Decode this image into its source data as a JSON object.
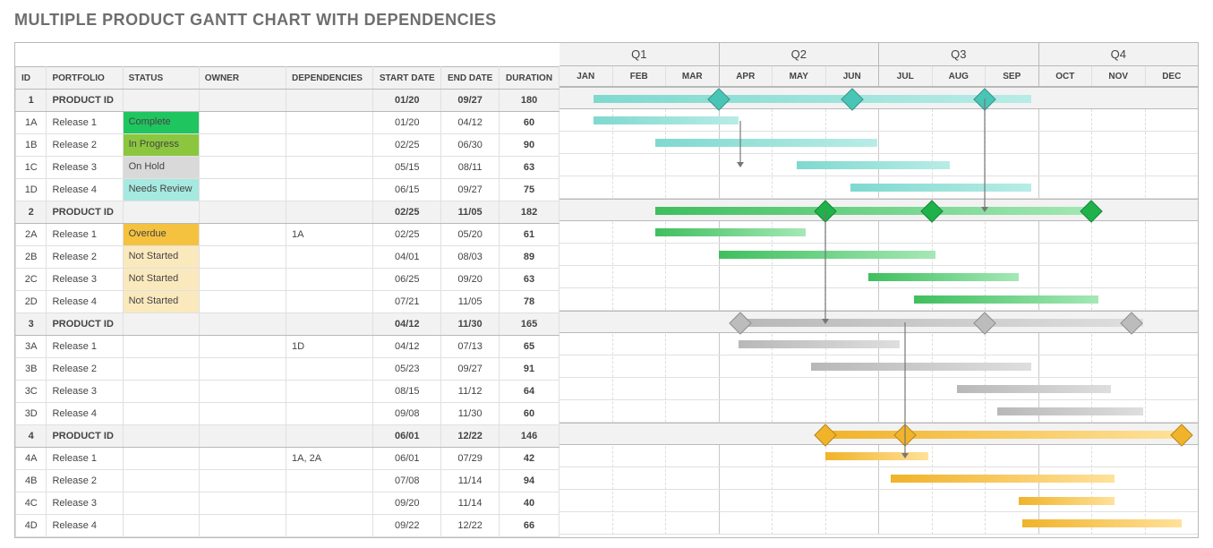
{
  "title": "MULTIPLE PRODUCT GANTT CHART WITH DEPENDENCIES",
  "columns": {
    "id": "ID",
    "portfolio": "PORTFOLIO",
    "status": "STATUS",
    "owner": "OWNER",
    "dependencies": "DEPENDENCIES",
    "start_date": "START DATE",
    "end_date": "END DATE",
    "duration": "DURATION"
  },
  "quarters": [
    "Q1",
    "Q2",
    "Q3",
    "Q4"
  ],
  "months": [
    "JAN",
    "FEB",
    "MAR",
    "APR",
    "MAY",
    "JUN",
    "JUL",
    "AUG",
    "SEP",
    "OCT",
    "NOV",
    "DEC"
  ],
  "status_colors": {
    "Complete": "#1fc65f",
    "In Progress": "#8cc63f",
    "On Hold": "#d9d9d9",
    "Needs Review": "#a6e9e0",
    "Overdue": "#f5c23f",
    "Not Started": "#fbe9be"
  },
  "product_colors": {
    "1": {
      "bar": "linear-gradient(90deg,#7fd9cf,#b8ece6)",
      "diamond": "#49c5b6"
    },
    "2": {
      "bar": "linear-gradient(90deg,#3fbf5e,#a5e8b6)",
      "diamond": "#1fb24a"
    },
    "3": {
      "bar": "linear-gradient(90deg,#b8b8b8,#dedede)",
      "diamond": "#bcbcbc"
    },
    "4": {
      "bar": "linear-gradient(90deg,#f0b32a,#ffe19a)",
      "diamond": "#f0b32a"
    }
  },
  "rows": [
    {
      "id": "1",
      "portfolio": "PRODUCT ID",
      "status": "",
      "owner": "",
      "dependencies": "",
      "start_date": "01/20",
      "end_date": "09/27",
      "duration": "180",
      "product": true,
      "group": "1",
      "diamonds": [
        4,
        6.5,
        9
      ]
    },
    {
      "id": "1A",
      "portfolio": "Release 1",
      "status": "Complete",
      "owner": "",
      "dependencies": "",
      "start_date": "01/20",
      "end_date": "04/12",
      "duration": "60",
      "group": "1"
    },
    {
      "id": "1B",
      "portfolio": "Release 2",
      "status": "In Progress",
      "owner": "",
      "dependencies": "",
      "start_date": "02/25",
      "end_date": "06/30",
      "duration": "90",
      "group": "1"
    },
    {
      "id": "1C",
      "portfolio": "Release 3",
      "status": "On Hold",
      "owner": "",
      "dependencies": "",
      "start_date": "05/15",
      "end_date": "08/11",
      "duration": "63",
      "group": "1"
    },
    {
      "id": "1D",
      "portfolio": "Release 4",
      "status": "Needs Review",
      "owner": "",
      "dependencies": "",
      "start_date": "06/15",
      "end_date": "09/27",
      "duration": "75",
      "group": "1"
    },
    {
      "id": "2",
      "portfolio": "PRODUCT ID",
      "status": "",
      "owner": "",
      "dependencies": "",
      "start_date": "02/25",
      "end_date": "11/05",
      "duration": "182",
      "product": true,
      "group": "2",
      "diamonds": [
        6,
        8,
        11
      ]
    },
    {
      "id": "2A",
      "portfolio": "Release 1",
      "status": "Overdue",
      "owner": "",
      "dependencies": "1A",
      "start_date": "02/25",
      "end_date": "05/20",
      "duration": "61",
      "group": "2"
    },
    {
      "id": "2B",
      "portfolio": "Release 2",
      "status": "Not Started",
      "owner": "",
      "dependencies": "",
      "start_date": "04/01",
      "end_date": "08/03",
      "duration": "89",
      "group": "2"
    },
    {
      "id": "2C",
      "portfolio": "Release 3",
      "status": "Not Started",
      "owner": "",
      "dependencies": "",
      "start_date": "06/25",
      "end_date": "09/20",
      "duration": "63",
      "group": "2"
    },
    {
      "id": "2D",
      "portfolio": "Release 4",
      "status": "Not Started",
      "owner": "",
      "dependencies": "",
      "start_date": "07/21",
      "end_date": "11/05",
      "duration": "78",
      "group": "2"
    },
    {
      "id": "3",
      "portfolio": "PRODUCT ID",
      "status": "",
      "owner": "",
      "dependencies": "",
      "start_date": "04/12",
      "end_date": "11/30",
      "duration": "165",
      "product": true,
      "group": "3",
      "diamonds": [
        4.4,
        9,
        11.75
      ]
    },
    {
      "id": "3A",
      "portfolio": "Release 1",
      "status": "",
      "owner": "",
      "dependencies": "1D",
      "start_date": "04/12",
      "end_date": "07/13",
      "duration": "65",
      "group": "3"
    },
    {
      "id": "3B",
      "portfolio": "Release 2",
      "status": "",
      "owner": "",
      "dependencies": "",
      "start_date": "05/23",
      "end_date": "09/27",
      "duration": "91",
      "group": "3"
    },
    {
      "id": "3C",
      "portfolio": "Release 3",
      "status": "",
      "owner": "",
      "dependencies": "",
      "start_date": "08/15",
      "end_date": "11/12",
      "duration": "64",
      "group": "3"
    },
    {
      "id": "3D",
      "portfolio": "Release 4",
      "status": "",
      "owner": "",
      "dependencies": "",
      "start_date": "09/08",
      "end_date": "11/30",
      "duration": "60",
      "group": "3"
    },
    {
      "id": "4",
      "portfolio": "PRODUCT ID",
      "status": "",
      "owner": "",
      "dependencies": "",
      "start_date": "06/01",
      "end_date": "12/22",
      "duration": "146",
      "product": true,
      "group": "4",
      "diamonds": [
        6,
        7.5,
        12.7
      ]
    },
    {
      "id": "4A",
      "portfolio": "Release 1",
      "status": "",
      "owner": "",
      "dependencies": "1A, 2A",
      "start_date": "06/01",
      "end_date": "07/29",
      "duration": "42",
      "group": "4"
    },
    {
      "id": "4B",
      "portfolio": "Release 2",
      "status": "",
      "owner": "",
      "dependencies": "",
      "start_date": "07/08",
      "end_date": "11/14",
      "duration": "94",
      "group": "4"
    },
    {
      "id": "4C",
      "portfolio": "Release 3",
      "status": "",
      "owner": "",
      "dependencies": "",
      "start_date": "09/20",
      "end_date": "11/14",
      "duration": "40",
      "group": "4"
    },
    {
      "id": "4D",
      "portfolio": "Release 4",
      "status": "",
      "owner": "",
      "dependencies": "",
      "start_date": "09/22",
      "end_date": "12/22",
      "duration": "66",
      "group": "4"
    }
  ],
  "dependencies_arrows": [
    {
      "from_row": 1,
      "to_row": 3,
      "x_month": 4.4
    },
    {
      "from_row": 0,
      "to_row": 5,
      "x_month": 9.0
    },
    {
      "from_row": 5,
      "to_row": 10,
      "x_month": 6.0
    },
    {
      "from_row": 10,
      "to_row": 16,
      "x_month": 7.5
    }
  ],
  "chart_data": {
    "type": "gantt",
    "title": "MULTIPLE PRODUCT GANTT CHART WITH DEPENDENCIES",
    "x_axis": {
      "quarters": [
        "Q1",
        "Q2",
        "Q3",
        "Q4"
      ],
      "months": [
        "JAN",
        "FEB",
        "MAR",
        "APR",
        "MAY",
        "JUN",
        "JUL",
        "AUG",
        "SEP",
        "OCT",
        "NOV",
        "DEC"
      ]
    },
    "tasks": [
      {
        "id": "1",
        "name": "PRODUCT ID",
        "start": "01/20",
        "end": "09/27",
        "duration": 180,
        "milestones": [
          "04",
          "06/15",
          "09"
        ]
      },
      {
        "id": "1A",
        "name": "Release 1",
        "status": "Complete",
        "start": "01/20",
        "end": "04/12",
        "duration": 60
      },
      {
        "id": "1B",
        "name": "Release 2",
        "status": "In Progress",
        "start": "02/25",
        "end": "06/30",
        "duration": 90
      },
      {
        "id": "1C",
        "name": "Release 3",
        "status": "On Hold",
        "start": "05/15",
        "end": "08/11",
        "duration": 63
      },
      {
        "id": "1D",
        "name": "Release 4",
        "status": "Needs Review",
        "start": "06/15",
        "end": "09/27",
        "duration": 75
      },
      {
        "id": "2",
        "name": "PRODUCT ID",
        "start": "02/25",
        "end": "11/05",
        "duration": 182,
        "milestones": [
          "06",
          "08",
          "11"
        ]
      },
      {
        "id": "2A",
        "name": "Release 1",
        "status": "Overdue",
        "depends_on": [
          "1A"
        ],
        "start": "02/25",
        "end": "05/20",
        "duration": 61
      },
      {
        "id": "2B",
        "name": "Release 2",
        "status": "Not Started",
        "start": "04/01",
        "end": "08/03",
        "duration": 89
      },
      {
        "id": "2C",
        "name": "Release 3",
        "status": "Not Started",
        "start": "06/25",
        "end": "09/20",
        "duration": 63
      },
      {
        "id": "2D",
        "name": "Release 4",
        "status": "Not Started",
        "start": "07/21",
        "end": "11/05",
        "duration": 78
      },
      {
        "id": "3",
        "name": "PRODUCT ID",
        "start": "04/12",
        "end": "11/30",
        "duration": 165,
        "milestones": [
          "04/12",
          "09",
          "11/22"
        ]
      },
      {
        "id": "3A",
        "name": "Release 1",
        "depends_on": [
          "1D"
        ],
        "start": "04/12",
        "end": "07/13",
        "duration": 65
      },
      {
        "id": "3B",
        "name": "Release 2",
        "start": "05/23",
        "end": "09/27",
        "duration": 91
      },
      {
        "id": "3C",
        "name": "Release 3",
        "start": "08/15",
        "end": "11/12",
        "duration": 64
      },
      {
        "id": "3D",
        "name": "Release 4",
        "start": "09/08",
        "end": "11/30",
        "duration": 60
      },
      {
        "id": "4",
        "name": "PRODUCT ID",
        "start": "06/01",
        "end": "12/22",
        "duration": 146,
        "milestones": [
          "06",
          "07/15",
          "12/22"
        ]
      },
      {
        "id": "4A",
        "name": "Release 1",
        "depends_on": [
          "1A",
          "2A"
        ],
        "start": "06/01",
        "end": "07/29",
        "duration": 42
      },
      {
        "id": "4B",
        "name": "Release 2",
        "start": "07/08",
        "end": "11/14",
        "duration": 94
      },
      {
        "id": "4C",
        "name": "Release 3",
        "start": "09/20",
        "end": "11/14",
        "duration": 40
      },
      {
        "id": "4D",
        "name": "Release 4",
        "start": "09/22",
        "end": "12/22",
        "duration": 66
      }
    ]
  }
}
